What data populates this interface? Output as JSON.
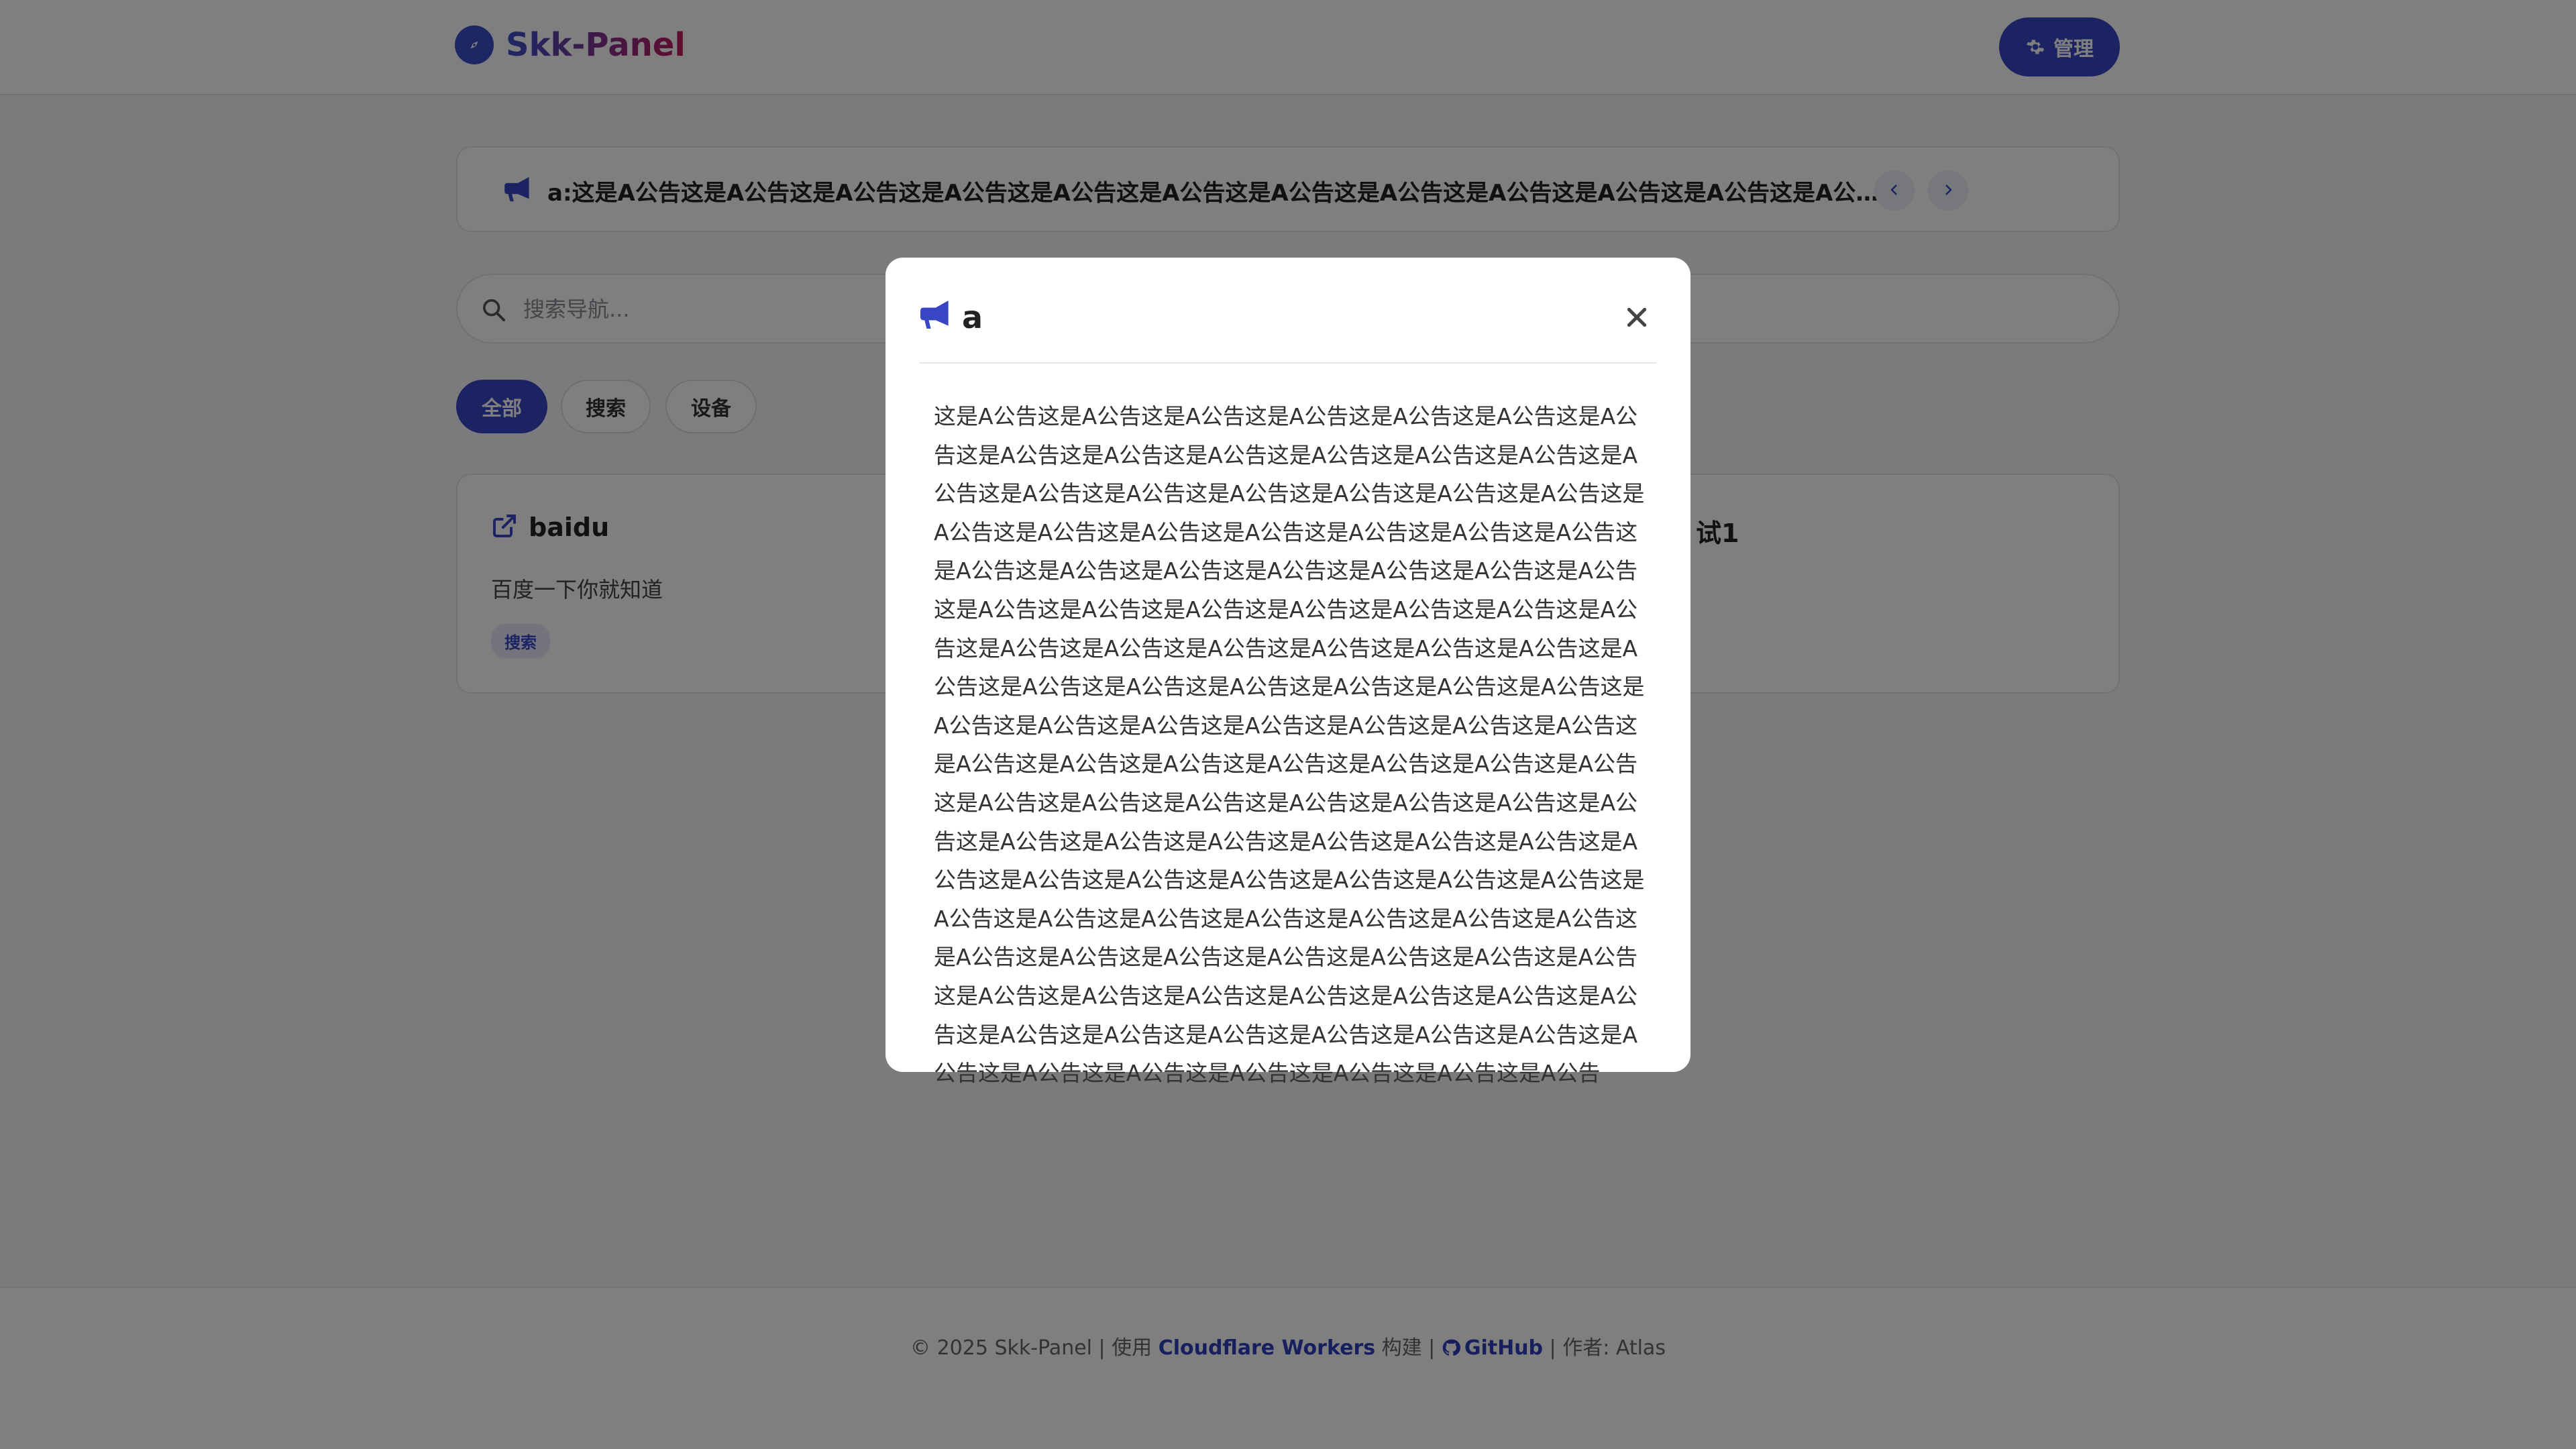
{
  "header": {
    "brand": "Skk-Panel",
    "admin_button": "管理"
  },
  "announcement": {
    "text": "a:这是A公告这是A公告这是A公告这是A公告这是A公告这是A公告这是A公告这是A公告这是A公告这是A公告这是A公告这是A公告这是A..."
  },
  "search": {
    "placeholder": "搜索导航..."
  },
  "categories": [
    "全部",
    "搜索",
    "设备"
  ],
  "cards": [
    {
      "title": "baidu",
      "description": "百度一下你就知道",
      "tag": "搜索"
    },
    {
      "title": "试1"
    }
  ],
  "footer": {
    "copyright": "© 2025 Skk-Panel | 使用 ",
    "workers_link": "Cloudflare Workers",
    "built_with": " 构建 | ",
    "github_link": "GitHub",
    "author": " | 作者: Atlas"
  },
  "modal": {
    "title": "a",
    "body": "这是A公告这是A公告这是A公告这是A公告这是A公告这是A公告这是A公告这是A公告这是A公告这是A公告这是A公告这是A公告这是A公告这是A公告这是A公告这是A公告这是A公告这是A公告这是A公告这是A公告这是A公告这是A公告这是A公告这是A公告这是A公告这是A公告这是A公告这是A公告这是A公告这是A公告这是A公告这是A公告这是A公告这是A公告这是A公告这是A公告这是A公告这是A公告这是A公告这是A公告这是A公告这是A公告这是A公告这是A公告这是A公告这是A公告这是A公告这是A公告这是A公告这是A公告这是A公告这是A公告这是A公告这是A公告这是A公告这是A公告这是A公告这是A公告这是A公告这是A公告这是A公告这是A公告这是A公告这是A公告这是A公告这是A公告这是A公告这是A公告这是A公告这是A公告这是A公告这是A公告这是A公告这是A公告这是A公告这是A公告这是A公告这是A公告这是A公告这是A公告这是A公告这是A公告这是A公告这是A公告这是A公告这是A公告这是A公告这是A公告这是A公告这是A公告这是A公告这是A公告这是A公告这是A公告这是A公告这是A公告这是A公告这是A公告这是A公告这是A公告这是A公告这是A公告这是A公告这是A公告这是A公告这是A公告这是A公告这是A公告这是A公告这是A公告这是A公告这是A公告这是A公告这是A公告这是A公告这是A公告这是A公告这是A公告这是A公告这是A公告这是A公告这是A公告"
  },
  "colors": {
    "accent": "#3946c4",
    "brand_gradient_start": "#3b4fc9",
    "brand_gradient_end": "#c2185b",
    "overlay": "rgba(0,0,0,0.5)"
  },
  "icons": {
    "logo": "compass-icon",
    "admin": "gear-icon",
    "announcement": "megaphone-icon",
    "prev": "chevron-left-icon",
    "next": "chevron-right-icon",
    "search": "search-icon",
    "card_link": "external-link-icon",
    "github": "github-icon",
    "close": "close-icon"
  }
}
